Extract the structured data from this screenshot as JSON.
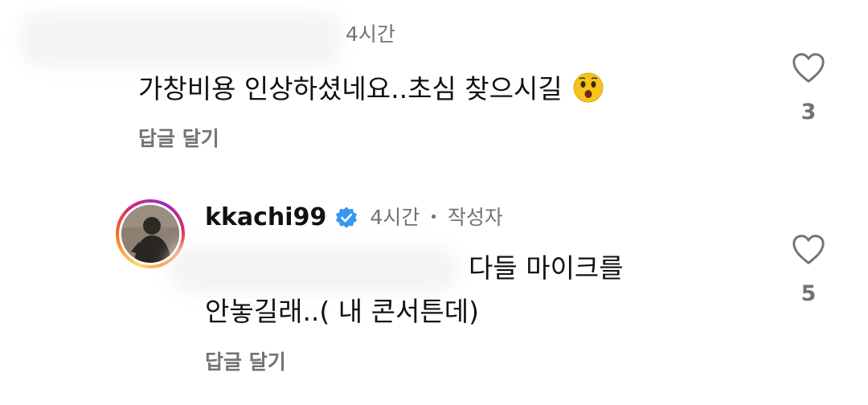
{
  "comments": [
    {
      "time": "4시간",
      "text": "가창비용 인상하셨네요..초심 찾으시길",
      "reply_label": "답글 달기",
      "like_count": "3"
    },
    {
      "username": "kkachi99",
      "time": "4시간",
      "separator": "•",
      "author_badge": "작성자",
      "text_line1": "다들 마이크를",
      "text_line2": "안놓길래..( 내 콘서튼데)",
      "reply_label": "답글 달기",
      "like_count": "5"
    }
  ],
  "icons": {
    "like": "heart-outline-icon",
    "verified": "verified-badge-icon",
    "emoji": "astonished-face-emoji"
  },
  "colors": {
    "text": "#111111",
    "muted": "#737373",
    "verified": "#3897f0",
    "heart_stroke": "#737373"
  }
}
